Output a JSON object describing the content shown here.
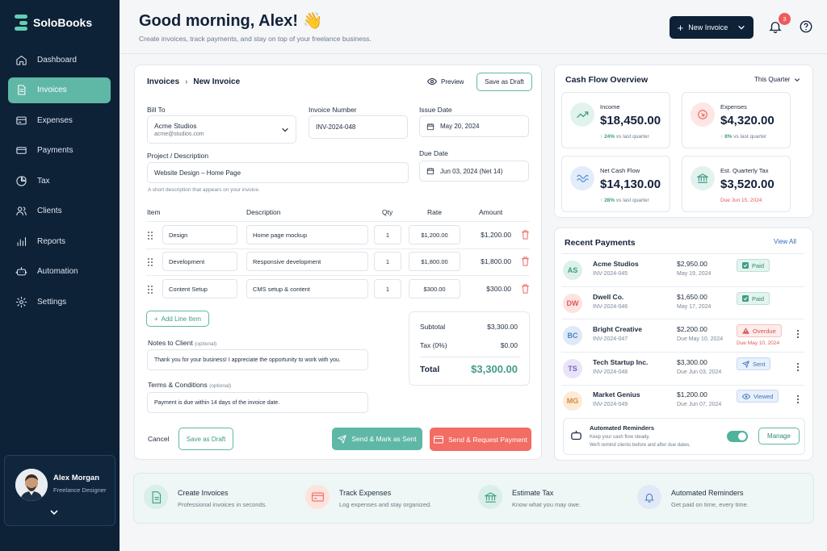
{
  "app": {
    "name": "SoloBooks"
  },
  "sidebar": {
    "items": [
      {
        "label": "Dashboard",
        "icon": "home-icon"
      },
      {
        "label": "Invoices",
        "icon": "invoice-icon",
        "active": true
      },
      {
        "label": "Expenses",
        "icon": "wallet-icon"
      },
      {
        "label": "Payments",
        "icon": "card-icon"
      },
      {
        "label": "Tax",
        "icon": "pie-chart-icon"
      },
      {
        "label": "Clients",
        "icon": "users-icon"
      },
      {
        "label": "Reports",
        "icon": "bar-chart-icon"
      },
      {
        "label": "Automation",
        "icon": "robot-icon"
      },
      {
        "label": "Settings",
        "icon": "gear-icon"
      }
    ],
    "profile": {
      "name": "Alex Morgan",
      "role": "Freelance Designer"
    }
  },
  "header": {
    "title": "Good morning, Alex! 👋",
    "subtitle": "Create invoices, track payments, and stay on top of your freelance business.",
    "new_invoice": "New Invoice",
    "notifications": "3"
  },
  "invoice": {
    "breadcrumb": {
      "parent": "Invoices",
      "sep": "›",
      "current": "New Invoice"
    },
    "preview": "Preview",
    "save_draft": "Save as Draft",
    "bill_to": {
      "label": "Bill To",
      "name": "Acme Studios",
      "email": "acme@studios.com"
    },
    "number": {
      "label": "Invoice Number",
      "value": "INV-2024-048"
    },
    "issue_date": {
      "label": "Issue Date",
      "value": "May 20, 2024"
    },
    "project": {
      "label": "Project / Description",
      "value": "Website Design – Home Page",
      "hint": "A short description that appears on your invoice."
    },
    "due_date": {
      "label": "Due Date",
      "value": "Jun 03, 2024 (Net 14)"
    },
    "columns": {
      "item": "Item",
      "description": "Description",
      "qty": "Qty",
      "rate": "Rate",
      "amount": "Amount"
    },
    "lines": [
      {
        "item": "Design",
        "description": "Home page mockup",
        "qty": "1",
        "rate": "$1,200.00",
        "amount": "$1,200.00"
      },
      {
        "item": "Development",
        "description": "Responsive development",
        "qty": "1",
        "rate": "$1,800.00",
        "amount": "$1,800.00"
      },
      {
        "item": "Content Setup",
        "description": "CMS setup & content",
        "qty": "1",
        "rate": "$300.00",
        "amount": "$300.00"
      }
    ],
    "add_line": "Add Line Item",
    "notes": {
      "label": "Notes to Client",
      "optional": "(optional)",
      "value": "Thank you for your business! I appreciate the opportunity to work with you."
    },
    "terms": {
      "label": "Terms & Conditions",
      "optional": "(optional)",
      "value": "Payment is due within 14 days of the invoice date."
    },
    "totals": {
      "subtotal_label": "Subtotal",
      "subtotal": "$3,300.00",
      "tax_label": "Tax (0%)",
      "tax": "$0.00",
      "total_label": "Total",
      "total": "$3,300.00"
    },
    "cancel": "Cancel",
    "save_draft_bottom": "Save as Draft",
    "send_mark": "Send & Mark as Sent",
    "send_request": "Send & Request Payment"
  },
  "cashflow": {
    "title": "Cash Flow Overview",
    "period": "This Quarter",
    "stats": [
      {
        "label": "Income",
        "value": "$18,450.00",
        "change": "24%",
        "change_note": "vs last quarter",
        "icon": "trend-up-icon"
      },
      {
        "label": "Expenses",
        "value": "$4,320.00",
        "change": "8%",
        "change_note": "vs last quarter",
        "icon": "arrow-down-right-icon"
      },
      {
        "label": "Net Cash Flow",
        "value": "$14,130.00",
        "change": "28%",
        "change_note": "vs last quarter",
        "icon": "wave-icon"
      },
      {
        "label": "Est. Quarterly Tax",
        "value": "$3,520.00",
        "change": "",
        "change_note": "Due Jun 15, 2024",
        "icon": "bank-icon"
      }
    ]
  },
  "payments": {
    "title": "Recent Payments",
    "view_all": "View All",
    "rows": [
      {
        "initials": "AS",
        "name": "Acme Studios",
        "invoice": "INV-2024-045",
        "amount": "$2,950.00",
        "date": "May 19, 2024",
        "status": "Paid",
        "sub": ""
      },
      {
        "initials": "DW",
        "name": "Dwell Co.",
        "invoice": "INV-2024-046",
        "amount": "$1,650.00",
        "date": "May 17, 2024",
        "status": "Paid",
        "sub": ""
      },
      {
        "initials": "BC",
        "name": "Bright Creative",
        "invoice": "INV-2024-047",
        "amount": "$2,200.00",
        "date": "Due May 10, 2024",
        "status": "Overdue",
        "sub": "Due May 10, 2024"
      },
      {
        "initials": "TS",
        "name": "Tech Startup Inc.",
        "invoice": "INV-2024-048",
        "amount": "$3,300.00",
        "date": "Due Jun 03, 2024",
        "status": "Sent",
        "sub": ""
      },
      {
        "initials": "MG",
        "name": "Market Genius",
        "invoice": "INV-2024-049",
        "amount": "$1,200.00",
        "date": "Due Jun 07, 2024",
        "status": "Viewed",
        "sub": ""
      }
    ],
    "reminders": {
      "title": "Automated Reminders",
      "line1": "Keep your cash flow steady.",
      "line2": "We'll remind clients before and after due dates.",
      "manage": "Manage",
      "enabled": true
    }
  },
  "features": [
    {
      "title": "Create Invoices",
      "sub": "Professional invoices in seconds.",
      "icon": "document-icon"
    },
    {
      "title": "Track  Expenses",
      "sub": "Log expenses and stay organized.",
      "icon": "card-icon"
    },
    {
      "title": "Estimate Tax",
      "sub": "Know what you may owe.",
      "icon": "bank-icon"
    },
    {
      "title": "Automated Reminders",
      "sub": "Get paid on time, every time.",
      "icon": "bell-icon"
    }
  ],
  "colors": {
    "brand": "#0d2137",
    "accent": "#5fb8a5",
    "green": "#3f9c88",
    "red": "#ef6b62",
    "blue": "#5b8fd6"
  }
}
